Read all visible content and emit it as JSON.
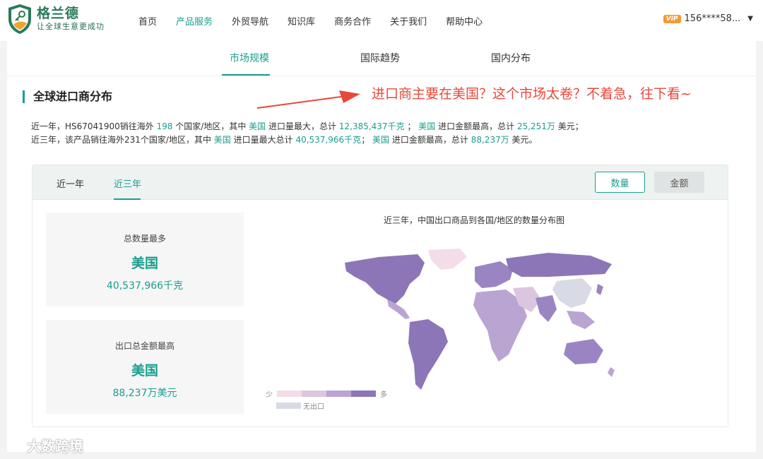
{
  "header": {
    "brand_name": "格兰德",
    "brand_slogan": "让全球生意更成功",
    "nav": [
      "首页",
      "产品服务",
      "外贸导航",
      "知识库",
      "商务合作",
      "关于我们",
      "帮助中心"
    ],
    "nav_active": "产品服务",
    "vip_badge": "VIP",
    "user_phone": "156****58..."
  },
  "subtabs": [
    "市场规模",
    "国际趋势",
    "国内分布"
  ],
  "section": {
    "title": "全球进口商分布",
    "annotation": "进口商主要在美国？这个市场太卷？不着急，往下看~"
  },
  "summary": {
    "year1": {
      "p1": "近一年，HS67041900销往海外",
      "countries": "198",
      "p2": "个国家/地区，其中",
      "top_qty_country": "美国",
      "p3": "进口量最大，总计",
      "qty": "12,385,437千克",
      "p4": "；",
      "top_amt_country": "美国",
      "p5": "进口金额最高，总计",
      "amt": "25,251万",
      "p6": "美元；"
    },
    "year3": {
      "p1": "近三年，该产品销往海外231个国家/地区，其中",
      "top_qty_country": "美国",
      "p2": "进口量最大总计",
      "qty": "40,537,966千克",
      "p3": "；",
      "top_amt_country": "美国",
      "p4": "进口金额最高，总计",
      "amt": "88,237万",
      "p5": "美元。"
    }
  },
  "panel": {
    "tabs": [
      "近一年",
      "近三年"
    ],
    "active_tab": "近三年",
    "buttons": {
      "quantity": "数量",
      "amount": "金额"
    },
    "stats": [
      {
        "label": "总数量最多",
        "country": "美国",
        "value": "40,537,966千克"
      },
      {
        "label": "出口总金额最高",
        "country": "美国",
        "value": "88,237万美元"
      }
    ],
    "map_title": "近三年，中国出口商品到各国/地区的数量分布图",
    "legend": {
      "low": "少",
      "high": "多",
      "none": "无出口"
    }
  },
  "colors": {
    "accent": "#1a9e8e",
    "annotation": "#e8483a",
    "map_scale": [
      "#f3dde8",
      "#dcc6df",
      "#b9a4d2",
      "#9a85c2",
      "#8c76b8"
    ],
    "map_none": "#d8dbe6"
  },
  "watermark": "大数跨境"
}
